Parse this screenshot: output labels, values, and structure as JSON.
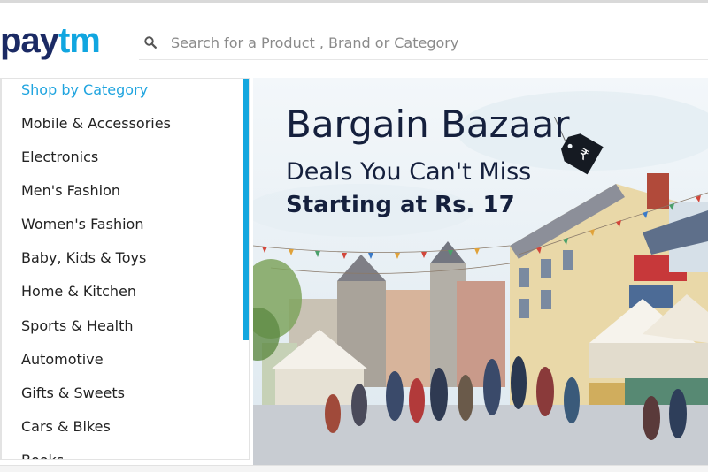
{
  "header": {
    "logo_part1": "pay",
    "logo_part2": "tm",
    "search_placeholder": "Search for a Product , Brand or Category",
    "search_icon": "search-icon"
  },
  "sidebar": {
    "title": "Shop by Category",
    "items": [
      "Mobile & Accessories",
      "Electronics",
      "Men's Fashion",
      "Women's Fashion",
      "Baby, Kids & Toys",
      "Home & Kitchen",
      "Sports & Health",
      "Automotive",
      "Gifts & Sweets",
      "Cars & Bikes",
      "Books"
    ]
  },
  "banner": {
    "title": "Bargain Bazaar",
    "subtitle": "Deals You Can't Miss",
    "offer": "Starting at Rs. 17",
    "tag_label": "₹"
  },
  "colors": {
    "brand_dark": "#1b2a64",
    "brand_light": "#11a6e0",
    "accent": "#1fa4df"
  }
}
